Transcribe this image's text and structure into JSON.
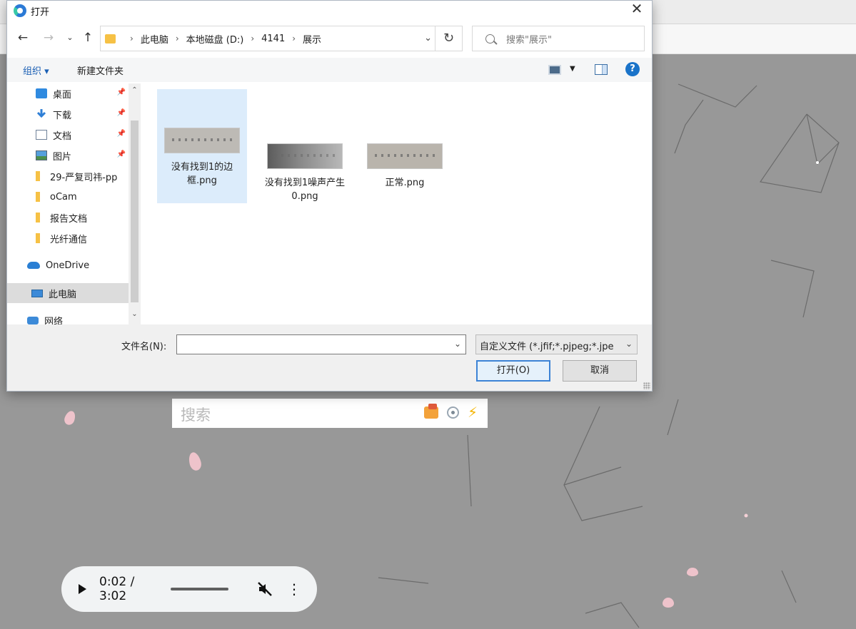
{
  "dialog": {
    "title": "打开",
    "breadcrumb": [
      "此电脑",
      "本地磁盘 (D:)",
      "4141",
      "展示"
    ],
    "search_placeholder": "搜索\"展示\"",
    "toolbar": {
      "organize": "组织 ▾",
      "new_folder": "新建文件夹"
    },
    "sidebar": [
      {
        "label": "桌面",
        "icon": "desktop-icon",
        "pinned": true
      },
      {
        "label": "下载",
        "icon": "download-icon",
        "pinned": true
      },
      {
        "label": "文档",
        "icon": "document-icon",
        "pinned": true
      },
      {
        "label": "图片",
        "icon": "pictures-icon",
        "pinned": true
      },
      {
        "label": "29-严复司祎-pp",
        "icon": "folder-icon",
        "pinned": false
      },
      {
        "label": "oCam",
        "icon": "folder-icon",
        "pinned": false
      },
      {
        "label": "报告文档",
        "icon": "folder-icon",
        "pinned": false
      },
      {
        "label": "光纤通信",
        "icon": "folder-icon",
        "pinned": false
      },
      {
        "label": "OneDrive",
        "icon": "cloud-icon",
        "pinned": false
      },
      {
        "label": "此电脑",
        "icon": "computer-icon",
        "pinned": false
      },
      {
        "label": "网络",
        "icon": "network-icon",
        "pinned": false
      }
    ],
    "files": [
      {
        "name": "没有找到1的边框.png",
        "selected": true
      },
      {
        "name": "没有找到1噪声产生0.png",
        "selected": false
      },
      {
        "name": "正常.png",
        "selected": false
      }
    ],
    "filename_label": "文件名(N):",
    "filename_value": "",
    "filetype_value": "自定义文件 (*.jfif;*.pjpeg;*.jpe",
    "open_button": "打开(O)",
    "cancel_button": "取消"
  },
  "background": {
    "search_placeholder": "搜索",
    "audio": {
      "time": "0:02 / 3:02"
    }
  },
  "colors": {
    "accent": "#1a73c9",
    "selection": "#dcecfb",
    "folder": "#f6c145"
  }
}
